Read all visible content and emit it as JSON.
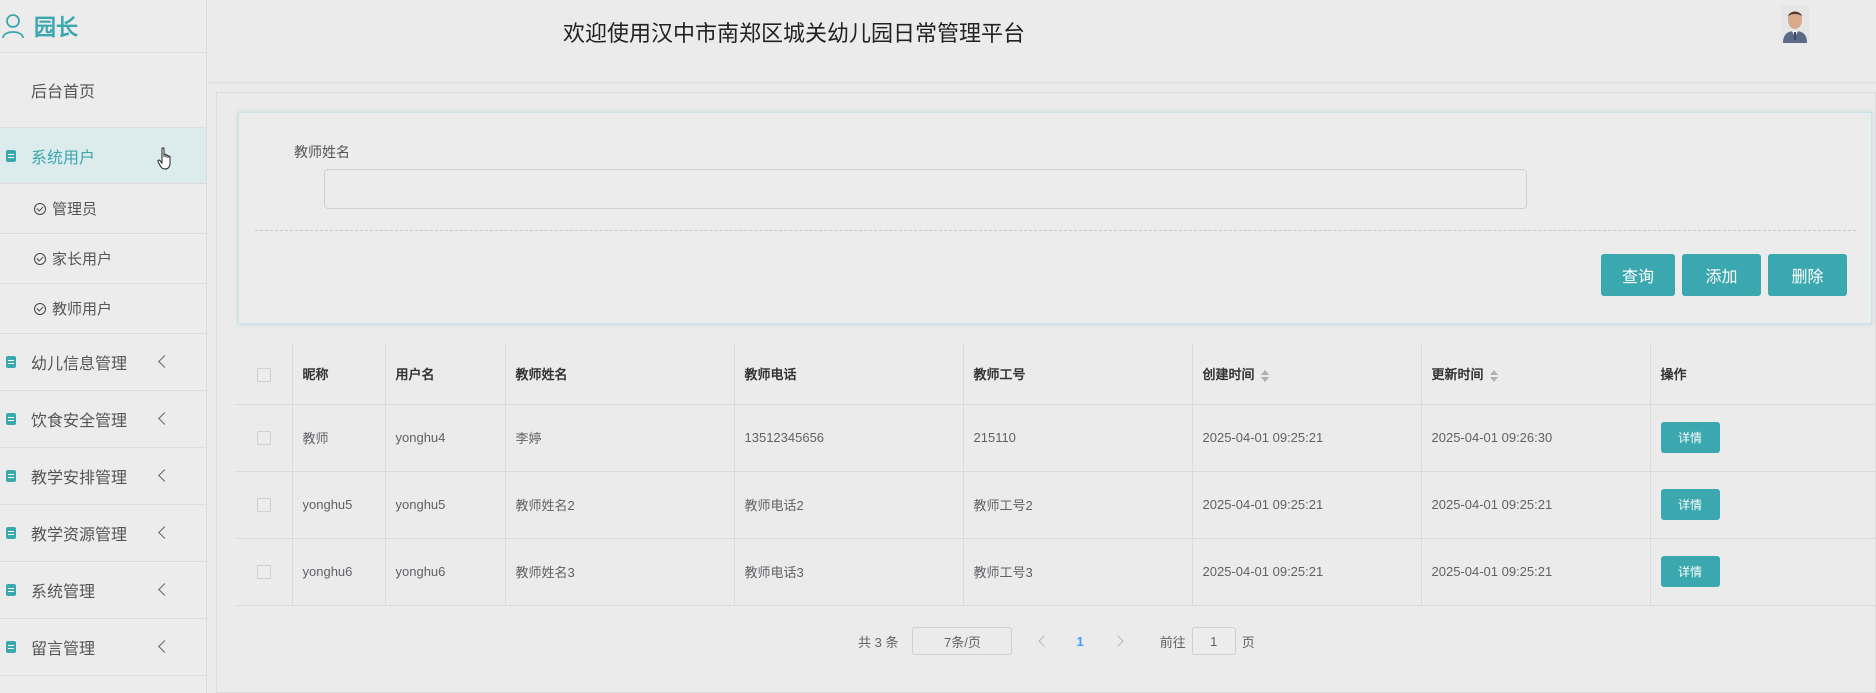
{
  "sidebar": {
    "role": "园长",
    "home": "后台首页",
    "active_menu": "系统用户",
    "sub_items": [
      "管理员",
      "家长用户",
      "教师用户"
    ],
    "menus": [
      "幼儿信息管理",
      "饮食安全管理",
      "教学安排管理",
      "教学资源管理",
      "系统管理",
      "留言管理"
    ]
  },
  "header": {
    "title": "欢迎使用汉中市南郑区城关幼儿园日常管理平台"
  },
  "search": {
    "label": "教师姓名",
    "value": "",
    "placeholder": "",
    "query_label": "查询",
    "add_label": "添加",
    "delete_label": "删除"
  },
  "table": {
    "columns": [
      "昵称",
      "用户名",
      "教师姓名",
      "教师电话",
      "教师工号",
      "创建时间",
      "更新时间",
      "操作"
    ],
    "rows": [
      {
        "nickname": "教师",
        "username": "yonghu4",
        "name": "李婷",
        "phone": "13512345656",
        "job_no": "215110",
        "created": "2025-04-01 09:25:21",
        "updated": "2025-04-01 09:26:30",
        "action": "详情"
      },
      {
        "nickname": "yonghu5",
        "username": "yonghu5",
        "name": "教师姓名2",
        "phone": "教师电话2",
        "job_no": "教师工号2",
        "created": "2025-04-01 09:25:21",
        "updated": "2025-04-01 09:25:21",
        "action": "详情"
      },
      {
        "nickname": "yonghu6",
        "username": "yonghu6",
        "name": "教师姓名3",
        "phone": "教师电话3",
        "job_no": "教师工号3",
        "created": "2025-04-01 09:25:21",
        "updated": "2025-04-01 09:25:21",
        "action": "详情"
      }
    ]
  },
  "pagination": {
    "total_text": "共 3 条",
    "page_size": "7条/页",
    "current_page": "1",
    "goto_label": "前往",
    "goto_value": "1",
    "page_suffix": "页"
  },
  "colors": {
    "accent": "#3ba7ae",
    "page_link": "#409eff"
  }
}
